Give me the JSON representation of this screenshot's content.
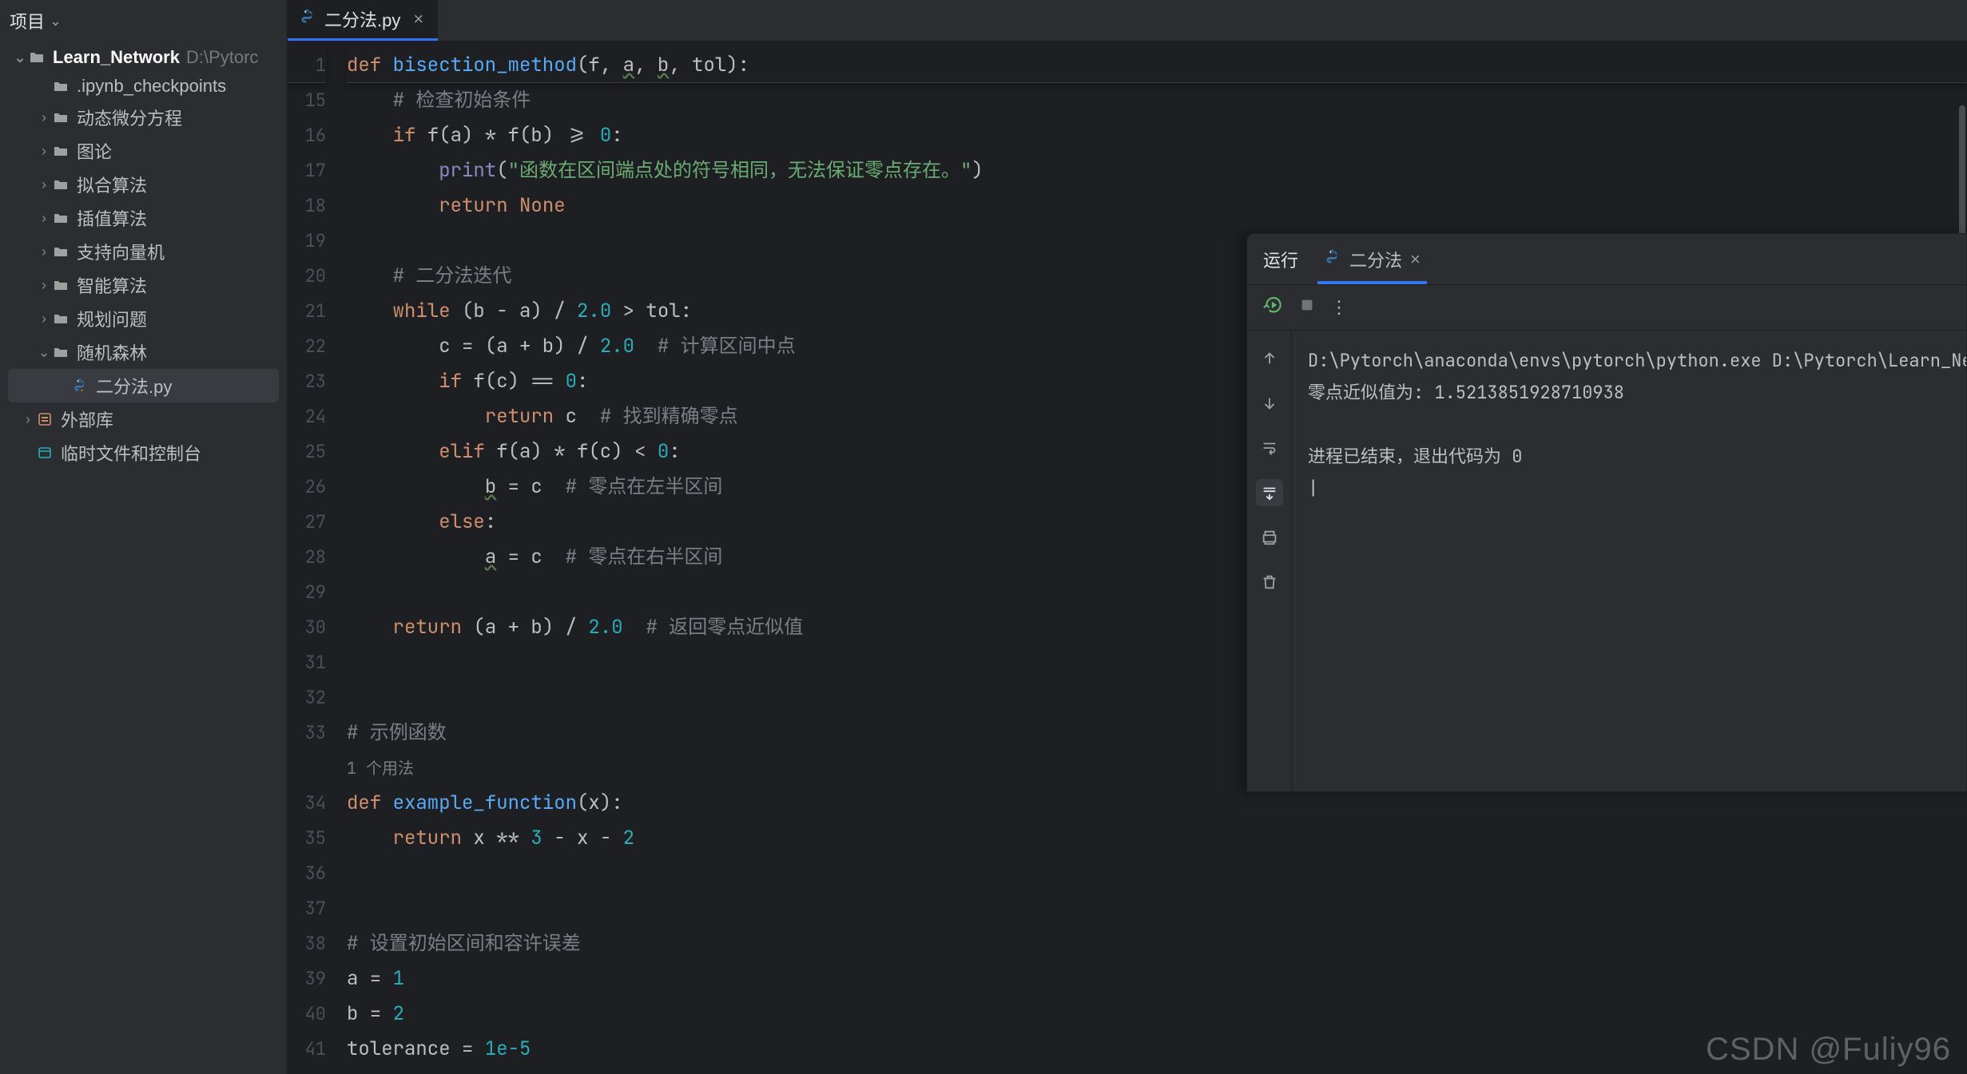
{
  "sidebar": {
    "title": "项目",
    "root": {
      "name": "Learn_Network",
      "path": "D:\\Pytorc"
    },
    "children": [
      {
        "label": ".ipynb_checkpoints",
        "kind": "folder",
        "expandable": false
      },
      {
        "label": "动态微分方程",
        "kind": "folder",
        "expandable": true
      },
      {
        "label": "图论",
        "kind": "folder",
        "expandable": true
      },
      {
        "label": "拟合算法",
        "kind": "folder",
        "expandable": true
      },
      {
        "label": "插值算法",
        "kind": "folder",
        "expandable": true
      },
      {
        "label": "支持向量机",
        "kind": "folder",
        "expandable": true
      },
      {
        "label": "智能算法",
        "kind": "folder",
        "expandable": true
      },
      {
        "label": "规划问题",
        "kind": "folder",
        "expandable": true
      },
      {
        "label": "随机森林",
        "kind": "folder",
        "expandable": true,
        "expanded": true
      },
      {
        "label": "二分法.py",
        "kind": "python",
        "selected": true
      }
    ],
    "external": {
      "label": "外部库"
    },
    "scratches": {
      "label": "临时文件和控制台"
    }
  },
  "tab": {
    "file": "二分法.py"
  },
  "editor": {
    "sticky_line_no": "1",
    "sticky_line": [
      {
        "t": "def ",
        "c": "kw"
      },
      {
        "t": "bisection_method",
        "c": "fn"
      },
      {
        "t": "(f, ",
        "c": "param"
      },
      {
        "t": "a",
        "c": "underline"
      },
      {
        "t": ", ",
        "c": "param"
      },
      {
        "t": "b",
        "c": "underline"
      },
      {
        "t": ", tol):",
        "c": "param"
      }
    ],
    "lines": [
      {
        "n": "15",
        "seg": [
          {
            "t": "    ",
            "c": ""
          },
          {
            "t": "# 检查初始条件",
            "c": "com"
          }
        ]
      },
      {
        "n": "16",
        "seg": [
          {
            "t": "    ",
            "c": ""
          },
          {
            "t": "if",
            "c": "kw"
          },
          {
            "t": " f(a) * f(b) >= ",
            "c": "op"
          },
          {
            "t": "0",
            "c": "num"
          },
          {
            "t": ":",
            "c": "op"
          }
        ]
      },
      {
        "n": "17",
        "seg": [
          {
            "t": "        ",
            "c": ""
          },
          {
            "t": "print",
            "c": "builtin"
          },
          {
            "t": "(",
            "c": "op"
          },
          {
            "t": "\"函数在区间端点处的符号相同，无法保证零点存在。\"",
            "c": "str"
          },
          {
            "t": ")",
            "c": "op"
          }
        ]
      },
      {
        "n": "18",
        "seg": [
          {
            "t": "        ",
            "c": ""
          },
          {
            "t": "return",
            "c": "kw"
          },
          {
            "t": " ",
            "c": ""
          },
          {
            "t": "None",
            "c": "kw"
          }
        ]
      },
      {
        "n": "19",
        "seg": [
          {
            "t": "",
            "c": ""
          }
        ]
      },
      {
        "n": "20",
        "seg": [
          {
            "t": "    ",
            "c": ""
          },
          {
            "t": "# 二分法迭代",
            "c": "com"
          }
        ]
      },
      {
        "n": "21",
        "seg": [
          {
            "t": "    ",
            "c": ""
          },
          {
            "t": "while",
            "c": "kw"
          },
          {
            "t": " (b - a) / ",
            "c": "op"
          },
          {
            "t": "2.0",
            "c": "num"
          },
          {
            "t": " > tol:",
            "c": "op"
          }
        ]
      },
      {
        "n": "22",
        "seg": [
          {
            "t": "        c = (a + b) / ",
            "c": "op"
          },
          {
            "t": "2.0",
            "c": "num"
          },
          {
            "t": "  ",
            "c": ""
          },
          {
            "t": "# 计算区间中点",
            "c": "com"
          }
        ]
      },
      {
        "n": "23",
        "seg": [
          {
            "t": "        ",
            "c": ""
          },
          {
            "t": "if",
            "c": "kw"
          },
          {
            "t": " f(c) == ",
            "c": "op"
          },
          {
            "t": "0",
            "c": "num"
          },
          {
            "t": ":",
            "c": "op"
          }
        ]
      },
      {
        "n": "24",
        "seg": [
          {
            "t": "            ",
            "c": ""
          },
          {
            "t": "return",
            "c": "kw"
          },
          {
            "t": " c  ",
            "c": "op"
          },
          {
            "t": "# 找到精确零点",
            "c": "com"
          }
        ]
      },
      {
        "n": "25",
        "seg": [
          {
            "t": "        ",
            "c": ""
          },
          {
            "t": "elif",
            "c": "kw"
          },
          {
            "t": " f(a) * f(c) < ",
            "c": "op"
          },
          {
            "t": "0",
            "c": "num"
          },
          {
            "t": ":",
            "c": "op"
          }
        ]
      },
      {
        "n": "26",
        "seg": [
          {
            "t": "            ",
            "c": ""
          },
          {
            "t": "b",
            "c": "underline"
          },
          {
            "t": " = c  ",
            "c": "op"
          },
          {
            "t": "# 零点在左半区间",
            "c": "com"
          }
        ]
      },
      {
        "n": "27",
        "seg": [
          {
            "t": "        ",
            "c": ""
          },
          {
            "t": "else",
            "c": "kw"
          },
          {
            "t": ":",
            "c": "op"
          }
        ]
      },
      {
        "n": "28",
        "seg": [
          {
            "t": "            ",
            "c": ""
          },
          {
            "t": "a",
            "c": "underline"
          },
          {
            "t": " = c  ",
            "c": "op"
          },
          {
            "t": "# 零点在右半区间",
            "c": "com"
          }
        ]
      },
      {
        "n": "29",
        "seg": [
          {
            "t": "",
            "c": ""
          }
        ]
      },
      {
        "n": "30",
        "seg": [
          {
            "t": "    ",
            "c": ""
          },
          {
            "t": "return",
            "c": "kw"
          },
          {
            "t": " (a + b) / ",
            "c": "op"
          },
          {
            "t": "2.0",
            "c": "num"
          },
          {
            "t": "  ",
            "c": ""
          },
          {
            "t": "# 返回零点近似值",
            "c": "com"
          }
        ]
      },
      {
        "n": "31",
        "seg": [
          {
            "t": "",
            "c": ""
          }
        ]
      },
      {
        "n": "32",
        "seg": [
          {
            "t": "",
            "c": ""
          }
        ]
      },
      {
        "n": "33",
        "seg": [
          {
            "t": "",
            "c": ""
          },
          {
            "t": "# 示例函数",
            "c": "com"
          }
        ]
      },
      {
        "n": "",
        "seg": [
          {
            "t": "1 个用法",
            "c": "inlay"
          }
        ]
      },
      {
        "n": "34",
        "seg": [
          {
            "t": "",
            "c": ""
          },
          {
            "t": "def ",
            "c": "kw"
          },
          {
            "t": "example_function",
            "c": "fn"
          },
          {
            "t": "(x):",
            "c": "param"
          }
        ]
      },
      {
        "n": "35",
        "seg": [
          {
            "t": "    ",
            "c": ""
          },
          {
            "t": "return",
            "c": "kw"
          },
          {
            "t": " x ** ",
            "c": "op"
          },
          {
            "t": "3",
            "c": "num"
          },
          {
            "t": " - x - ",
            "c": "op"
          },
          {
            "t": "2",
            "c": "num"
          }
        ]
      },
      {
        "n": "36",
        "seg": [
          {
            "t": "",
            "c": ""
          }
        ]
      },
      {
        "n": "37",
        "seg": [
          {
            "t": "",
            "c": ""
          }
        ]
      },
      {
        "n": "38",
        "seg": [
          {
            "t": "",
            "c": ""
          },
          {
            "t": "# 设置初始区间和容许误差",
            "c": "com"
          }
        ]
      },
      {
        "n": "39",
        "seg": [
          {
            "t": "a = ",
            "c": "op"
          },
          {
            "t": "1",
            "c": "num"
          }
        ]
      },
      {
        "n": "40",
        "seg": [
          {
            "t": "b = ",
            "c": "op"
          },
          {
            "t": "2",
            "c": "num"
          }
        ]
      },
      {
        "n": "41",
        "seg": [
          {
            "t": "tolerance = ",
            "c": "op"
          },
          {
            "t": "1e-5",
            "c": "num"
          }
        ]
      }
    ]
  },
  "run": {
    "label": "运行",
    "tab": "二分法",
    "output": [
      "D:\\Pytorch\\anaconda\\envs\\pytorch\\python.exe D:\\Pytorch\\Learn_Network\\二分",
      "零点近似值为: 1.5213851928710938",
      "",
      "进程已结束，退出代码为 0",
      "|"
    ]
  },
  "watermark": "CSDN @Fuliy96"
}
